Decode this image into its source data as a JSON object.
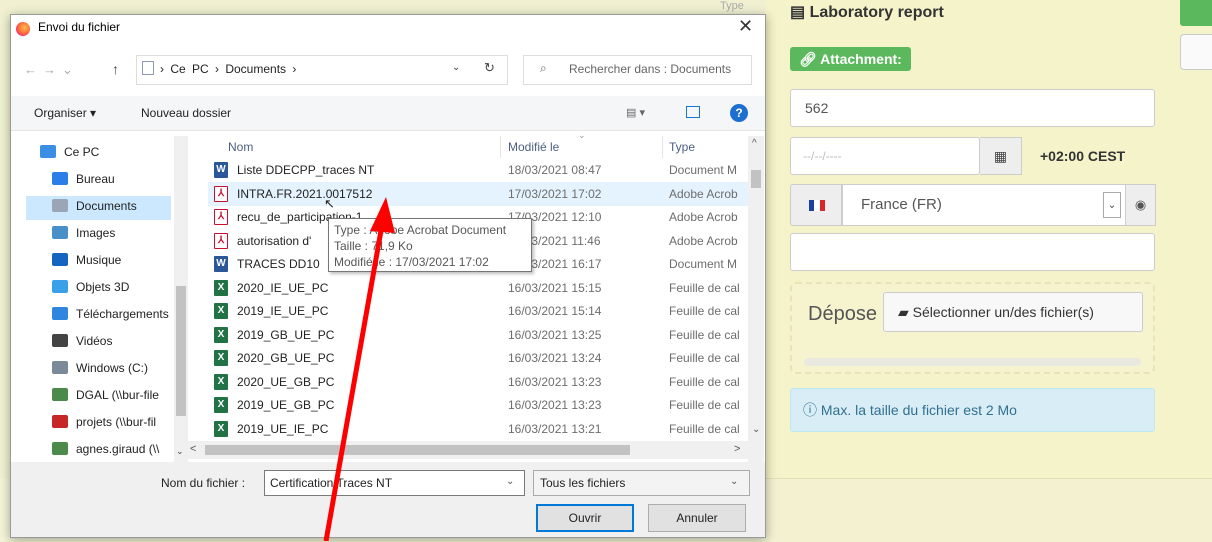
{
  "background_form": {
    "type_fragment": "Type",
    "lab_title": "Laboratory report",
    "attachment_label": "Attachment:",
    "number_value": "562",
    "date_placeholder": "--/--/----",
    "timezone": "+02:00 CEST",
    "country": "France (FR)",
    "drop_text": "Dépose",
    "select_files_button": "Sélectionner un/des fichier(s)",
    "max_size_info": "Max. la taille du fichier est 2 Mo",
    "flag_colors": [
      "#1f3fa1",
      "#ffffff",
      "#d8262c"
    ],
    "accent_green": "#5cb85c"
  },
  "dialog": {
    "title": "Envoi du fichier",
    "close_label": "✕",
    "address": {
      "path_text": "› Ce PC › Documents ›",
      "search_placeholder": "Rechercher dans : Documents"
    },
    "toolbar": {
      "organize": "Organiser ▾",
      "new_folder": "Nouveau dossier",
      "help": "?"
    },
    "nav_items": [
      {
        "label": "Ce PC",
        "icon": "computer-icon",
        "color": "#3a8ee6"
      },
      {
        "label": "Bureau",
        "icon": "desktop-icon",
        "color": "#2b7de9"
      },
      {
        "label": "Documents",
        "icon": "documents-icon",
        "color": "#9aa6b5"
      },
      {
        "label": "Images",
        "icon": "pictures-icon",
        "color": "#4a90c8"
      },
      {
        "label": "Musique",
        "icon": "music-icon",
        "color": "#1565c0"
      },
      {
        "label": "Objets 3D",
        "icon": "objects-3d-icon",
        "color": "#3aa0e8"
      },
      {
        "label": "Téléchargements",
        "icon": "downloads-icon",
        "color": "#2e86de"
      },
      {
        "label": "Vidéos",
        "icon": "videos-icon",
        "color": "#444444"
      },
      {
        "label": "Windows (C:)",
        "icon": "drive-icon",
        "color": "#7a8a99"
      },
      {
        "label": "DGAL (\\\\bur-file",
        "icon": "network-drive-icon",
        "color": "#4b8a4b"
      },
      {
        "label": "projets (\\\\bur-fil",
        "icon": "disconnected-drive-icon",
        "color": "#c62828"
      },
      {
        "label": "agnes.giraud (\\\\",
        "icon": "network-drive-icon",
        "color": "#4b8a4b"
      }
    ],
    "columns": {
      "name": "Nom",
      "modified": "Modifié le",
      "type": "Type"
    },
    "files": [
      {
        "name": "Liste DDECPP_traces NT",
        "modified": "18/03/2021 08:47",
        "type": "Document M",
        "icon": "W"
      },
      {
        "name": "INTRA.FR.2021.0017512",
        "modified": "17/03/2021 17:02",
        "type": "Adobe Acrob",
        "icon": "PDF"
      },
      {
        "name": "recu_de_participation-1",
        "modified": "17/03/2021 12:10",
        "type": "Adobe Acrob",
        "icon": "PDF"
      },
      {
        "name": "autorisation d'",
        "modified": "17/03/2021 11:46",
        "type": "Adobe Acrob",
        "icon": "PDF"
      },
      {
        "name": "TRACES DD10",
        "modified": "17/03/2021 16:17",
        "type": "Document M",
        "icon": "W"
      },
      {
        "name": "2020_IE_UE_PC",
        "modified": "16/03/2021 15:15",
        "type": "Feuille de cal",
        "icon": "X"
      },
      {
        "name": "2019_IE_UE_PC",
        "modified": "16/03/2021 15:14",
        "type": "Feuille de cal",
        "icon": "X"
      },
      {
        "name": "2019_GB_UE_PC",
        "modified": "16/03/2021 13:25",
        "type": "Feuille de cal",
        "icon": "X"
      },
      {
        "name": "2020_GB_UE_PC",
        "modified": "16/03/2021 13:24",
        "type": "Feuille de cal",
        "icon": "X"
      },
      {
        "name": "2020_UE_GB_PC",
        "modified": "16/03/2021 13:23",
        "type": "Feuille de cal",
        "icon": "X"
      },
      {
        "name": "2019_UE_GB_PC",
        "modified": "16/03/2021 13:23",
        "type": "Feuille de cal",
        "icon": "X"
      },
      {
        "name": "2019_UE_IE_PC",
        "modified": "16/03/2021 13:21",
        "type": "Feuille de cal",
        "icon": "X"
      }
    ],
    "tooltip": {
      "type": "Type : Adobe Acrobat Document",
      "size": "Taille : 71,9 Ko",
      "modified": "Modifié le : 17/03/2021 17:02"
    },
    "filename_label": "Nom du fichier :",
    "filename_value": "Certification Traces NT",
    "filter_value": "Tous les fichiers",
    "open_button": "Ouvrir",
    "cancel_button": "Annuler"
  },
  "annotation": {
    "arrow_color": "#ff0000"
  }
}
